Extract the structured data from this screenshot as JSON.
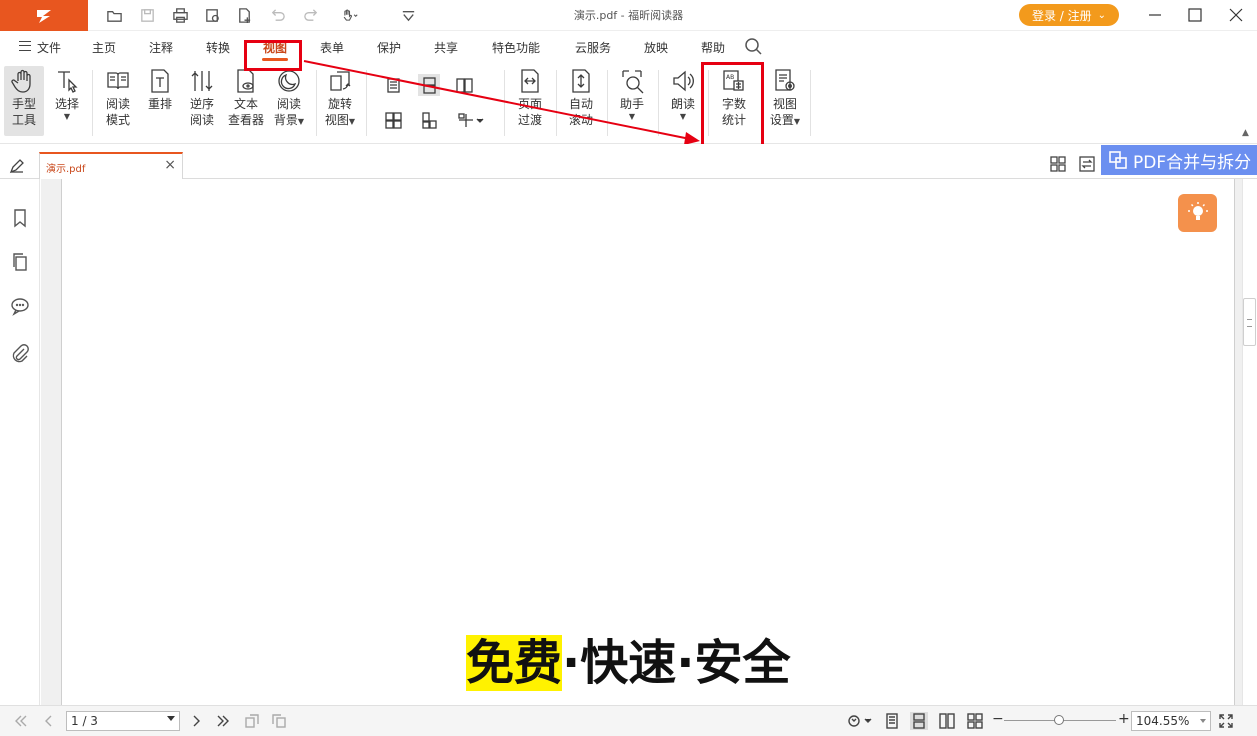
{
  "window": {
    "title": "演示.pdf - 福昕阅读器",
    "login_label": "登录 / 注册",
    "brand_color": "#e8561f"
  },
  "menu": {
    "file": "文件",
    "items": [
      "主页",
      "注释",
      "转换",
      "视图",
      "表单",
      "保护",
      "共享",
      "特色功能",
      "云服务",
      "放映",
      "帮助"
    ],
    "active": "视图"
  },
  "ribbon": {
    "hand_tool": [
      "手型",
      "工具"
    ],
    "select": "选择",
    "read_mode": [
      "阅读",
      "模式"
    ],
    "reflow": "重排",
    "reverse_read": [
      "逆序",
      "阅读"
    ],
    "text_viewer": [
      "文本",
      "查看器"
    ],
    "read_bg": [
      "阅读",
      "背景"
    ],
    "rotate_view": [
      "旋转",
      "视图"
    ],
    "page_transition": [
      "页面",
      "过渡"
    ],
    "auto_scroll": [
      "自动",
      "滚动"
    ],
    "assistant": "助手",
    "read_aloud": "朗读",
    "word_count": [
      "字数",
      "统计"
    ],
    "view_settings": [
      "视图",
      "设置"
    ]
  },
  "tabs": {
    "doc_tab": "演示.pdf",
    "banner": "PDF合并与拆分"
  },
  "document": {
    "slogan_highlight": "免费",
    "slogan_rest": "·快速·安全"
  },
  "status": {
    "page": "1 / 3",
    "zoom": "104.55%"
  },
  "annotation": {
    "color": "#e60012"
  }
}
